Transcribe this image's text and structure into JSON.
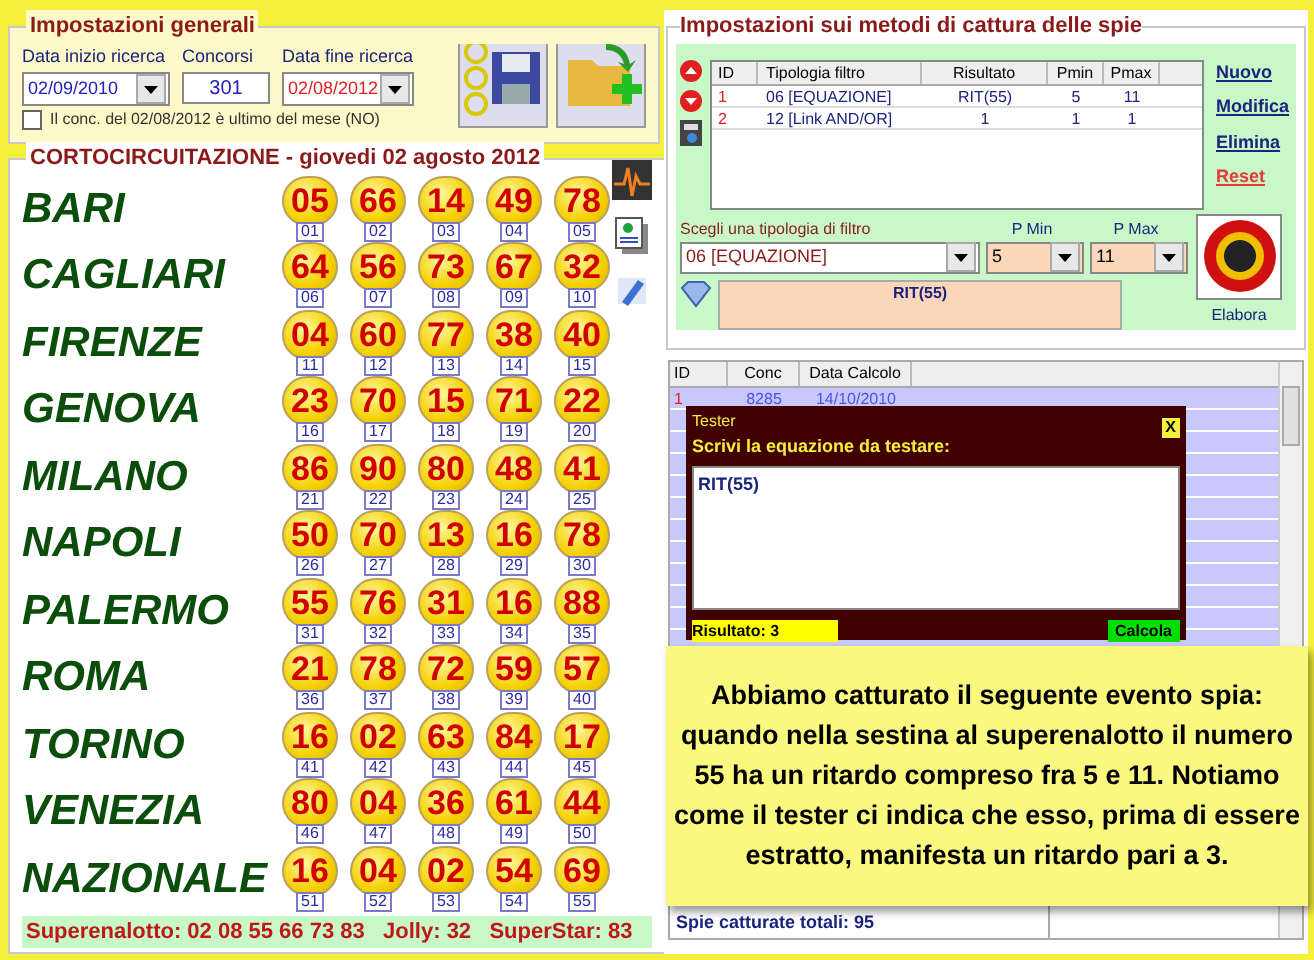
{
  "general": {
    "title": "Impostazioni generali",
    "start_label": "Data inizio ricerca",
    "start_value": "02/09/2010",
    "concorsi_label": "Concorsi",
    "concorsi_value": "301",
    "end_label": "Data fine ricerca",
    "end_value": "02/08/2012",
    "checkbox": {
      "label": "Il conc. del 02/08/2012 è ultimo del mese (NO)",
      "checked": false
    }
  },
  "draw": {
    "title": "CORTOCIRCUITAZIONE - giovedi 02 agosto 2012",
    "rows": [
      {
        "city": "BARI",
        "balls": [
          [
            "05",
            "01"
          ],
          [
            "66",
            "02"
          ],
          [
            "14",
            "03"
          ],
          [
            "49",
            "04"
          ],
          [
            "78",
            "05"
          ]
        ]
      },
      {
        "city": "CAGLIARI",
        "balls": [
          [
            "64",
            "06"
          ],
          [
            "56",
            "07"
          ],
          [
            "73",
            "08"
          ],
          [
            "67",
            "09"
          ],
          [
            "32",
            "10"
          ]
        ]
      },
      {
        "city": "FIRENZE",
        "balls": [
          [
            "04",
            "11"
          ],
          [
            "60",
            "12"
          ],
          [
            "77",
            "13"
          ],
          [
            "38",
            "14"
          ],
          [
            "40",
            "15"
          ]
        ]
      },
      {
        "city": "GENOVA",
        "balls": [
          [
            "23",
            "16"
          ],
          [
            "70",
            "17"
          ],
          [
            "15",
            "18"
          ],
          [
            "71",
            "19"
          ],
          [
            "22",
            "20"
          ]
        ]
      },
      {
        "city": "MILANO",
        "balls": [
          [
            "86",
            "21"
          ],
          [
            "90",
            "22"
          ],
          [
            "80",
            "23"
          ],
          [
            "48",
            "24"
          ],
          [
            "41",
            "25"
          ]
        ]
      },
      {
        "city": "NAPOLI",
        "balls": [
          [
            "50",
            "26"
          ],
          [
            "70",
            "27"
          ],
          [
            "13",
            "28"
          ],
          [
            "16",
            "29"
          ],
          [
            "78",
            "30"
          ]
        ]
      },
      {
        "city": "PALERMO",
        "balls": [
          [
            "55",
            "31"
          ],
          [
            "76",
            "32"
          ],
          [
            "31",
            "33"
          ],
          [
            "16",
            "34"
          ],
          [
            "88",
            "35"
          ]
        ]
      },
      {
        "city": "ROMA",
        "balls": [
          [
            "21",
            "36"
          ],
          [
            "78",
            "37"
          ],
          [
            "72",
            "38"
          ],
          [
            "59",
            "39"
          ],
          [
            "57",
            "40"
          ]
        ]
      },
      {
        "city": "TORINO",
        "balls": [
          [
            "16",
            "41"
          ],
          [
            "02",
            "42"
          ],
          [
            "63",
            "43"
          ],
          [
            "84",
            "44"
          ],
          [
            "17",
            "45"
          ]
        ]
      },
      {
        "city": "VENEZIA",
        "balls": [
          [
            "80",
            "46"
          ],
          [
            "04",
            "47"
          ],
          [
            "36",
            "48"
          ],
          [
            "61",
            "49"
          ],
          [
            "44",
            "50"
          ]
        ]
      },
      {
        "city": "NAZIONALE",
        "balls": [
          [
            "16",
            "51"
          ],
          [
            "04",
            "52"
          ],
          [
            "02",
            "53"
          ],
          [
            "54",
            "54"
          ],
          [
            "69",
            "55"
          ]
        ]
      }
    ],
    "footer": "Superenalotto: 02 08 55 66 73 83   Jolly: 32   SuperStar: 83"
  },
  "methods": {
    "title": "Impostazioni sui metodi di cattura delle spie",
    "columns": [
      "ID",
      "Tipologia filtro",
      "Risultato",
      "Pmin",
      "Pmax"
    ],
    "rows": [
      [
        "1",
        "06 [EQUAZIONE]",
        "RIT(55)",
        "5",
        "11"
      ],
      [
        "2",
        "12 [Link AND/OR]",
        "1",
        "1",
        "1"
      ]
    ],
    "links": [
      {
        "label": "Nuovo",
        "color": "#1a237e"
      },
      {
        "label": "Modifica",
        "color": "#1a237e"
      },
      {
        "label": "Elimina",
        "color": "#1a237e"
      },
      {
        "label": "Reset",
        "color": "#e53935"
      }
    ],
    "filter_label": "Scegli una tipologia di filtro",
    "filter_value": "06 [EQUAZIONE]",
    "pmin_label": "P Min",
    "pmin_value": "5",
    "pmax_label": "P Max",
    "pmax_value": "11",
    "expression": "RIT(55)",
    "run_label": "Elabora"
  },
  "results": {
    "columns": [
      "ID",
      "Conc",
      "Data Calcolo"
    ],
    "rows": [
      [
        "1",
        "8285",
        "14/10/2010"
      ]
    ],
    "total": "Spie catturate totali: 95"
  },
  "tester": {
    "title": "Tester",
    "close": "X",
    "prompt": "Scrivi la equazione da testare:",
    "equation": "RIT(55)",
    "result": "Risultato: 3",
    "button": "Calcola"
  },
  "note": "Abbiamo catturato il seguente evento spia: quando nella sestina al superenalotto il numero 55 ha un ritardo compreso fra 5 e 11. Notiamo come il tester ci indica che esso, prima di essere estratto, manifesta un ritardo pari a 3."
}
